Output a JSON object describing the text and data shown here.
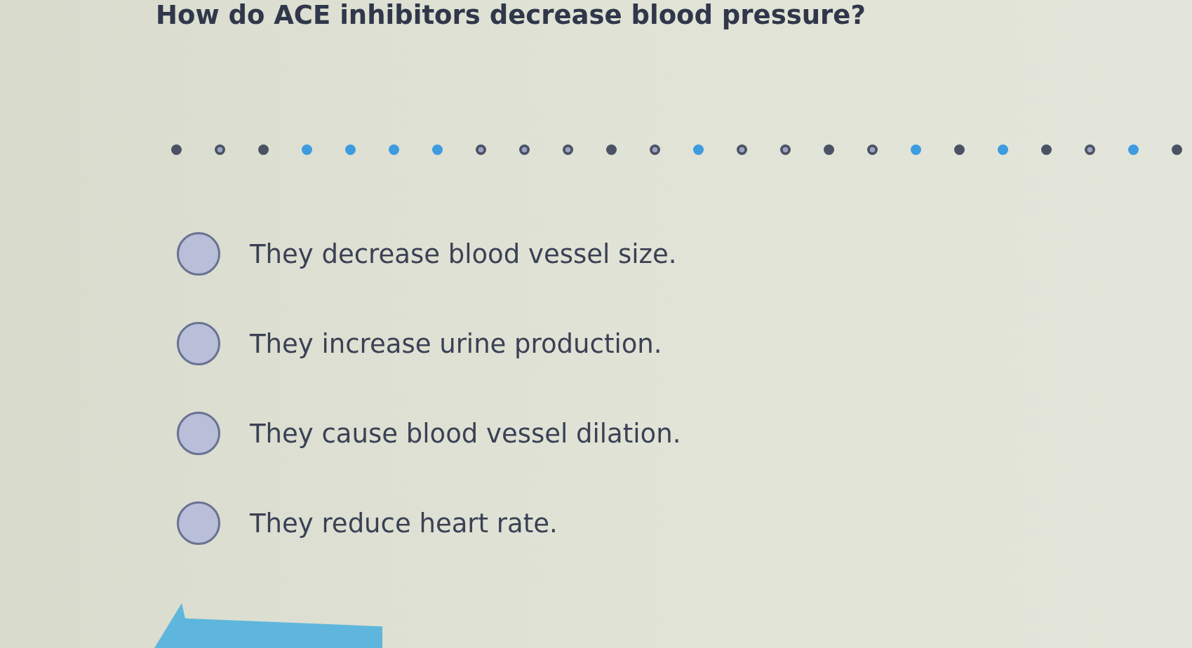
{
  "question": {
    "text": "How do ACE inhibitors decrease blood pressure?"
  },
  "progress_dots": [
    {
      "color": "#4b5263",
      "ringed": false
    },
    {
      "color": "#4b5263",
      "ringed": true
    },
    {
      "color": "#4b5263",
      "ringed": false
    },
    {
      "color": "#3d9be0",
      "ringed": false
    },
    {
      "color": "#3d9be0",
      "ringed": false
    },
    {
      "color": "#3d9be0",
      "ringed": false
    },
    {
      "color": "#3d9be0",
      "ringed": false
    },
    {
      "color": "#4b5263",
      "ringed": true
    },
    {
      "color": "#4b5263",
      "ringed": true
    },
    {
      "color": "#4b5263",
      "ringed": true
    },
    {
      "color": "#4b5263",
      "ringed": false
    },
    {
      "color": "#4b5263",
      "ringed": true
    },
    {
      "color": "#3d9be0",
      "ringed": false
    },
    {
      "color": "#4b5263",
      "ringed": true
    },
    {
      "color": "#4b5263",
      "ringed": true
    },
    {
      "color": "#4b5263",
      "ringed": false
    },
    {
      "color": "#4b5263",
      "ringed": true
    },
    {
      "color": "#3d9be0",
      "ringed": false
    },
    {
      "color": "#4b5263",
      "ringed": false
    },
    {
      "color": "#3d9be0",
      "ringed": false
    },
    {
      "color": "#4b5263",
      "ringed": false
    },
    {
      "color": "#4b5263",
      "ringed": true
    },
    {
      "color": "#3d9be0",
      "ringed": false
    },
    {
      "color": "#4b5263",
      "ringed": false
    }
  ],
  "options": [
    {
      "label": "They decrease blood vessel size.",
      "selected": false
    },
    {
      "label": "They increase urine production.",
      "selected": false
    },
    {
      "label": "They cause blood vessel dilation.",
      "selected": false
    },
    {
      "label": "They reduce heart rate.",
      "selected": false
    }
  ],
  "navigation": [
    {
      "kind": "back"
    }
  ]
}
